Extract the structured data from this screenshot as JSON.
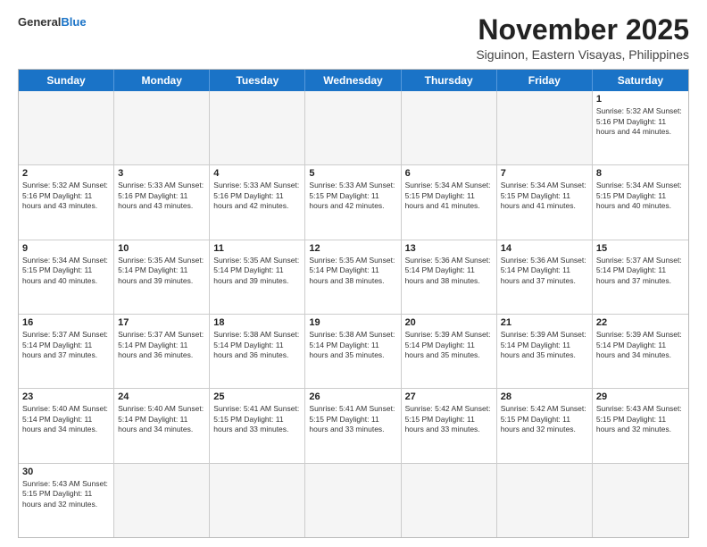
{
  "header": {
    "logo_line1": "General",
    "logo_line2": "Blue",
    "title": "November 2025",
    "subtitle": "Siguinon, Eastern Visayas, Philippines"
  },
  "weekdays": [
    "Sunday",
    "Monday",
    "Tuesday",
    "Wednesday",
    "Thursday",
    "Friday",
    "Saturday"
  ],
  "rows": [
    [
      {
        "day": "",
        "info": ""
      },
      {
        "day": "",
        "info": ""
      },
      {
        "day": "",
        "info": ""
      },
      {
        "day": "",
        "info": ""
      },
      {
        "day": "",
        "info": ""
      },
      {
        "day": "",
        "info": ""
      },
      {
        "day": "1",
        "info": "Sunrise: 5:32 AM\nSunset: 5:16 PM\nDaylight: 11 hours and 44 minutes."
      }
    ],
    [
      {
        "day": "2",
        "info": "Sunrise: 5:32 AM\nSunset: 5:16 PM\nDaylight: 11 hours and 43 minutes."
      },
      {
        "day": "3",
        "info": "Sunrise: 5:33 AM\nSunset: 5:16 PM\nDaylight: 11 hours and 43 minutes."
      },
      {
        "day": "4",
        "info": "Sunrise: 5:33 AM\nSunset: 5:16 PM\nDaylight: 11 hours and 42 minutes."
      },
      {
        "day": "5",
        "info": "Sunrise: 5:33 AM\nSunset: 5:15 PM\nDaylight: 11 hours and 42 minutes."
      },
      {
        "day": "6",
        "info": "Sunrise: 5:34 AM\nSunset: 5:15 PM\nDaylight: 11 hours and 41 minutes."
      },
      {
        "day": "7",
        "info": "Sunrise: 5:34 AM\nSunset: 5:15 PM\nDaylight: 11 hours and 41 minutes."
      },
      {
        "day": "8",
        "info": "Sunrise: 5:34 AM\nSunset: 5:15 PM\nDaylight: 11 hours and 40 minutes."
      }
    ],
    [
      {
        "day": "9",
        "info": "Sunrise: 5:34 AM\nSunset: 5:15 PM\nDaylight: 11 hours and 40 minutes."
      },
      {
        "day": "10",
        "info": "Sunrise: 5:35 AM\nSunset: 5:14 PM\nDaylight: 11 hours and 39 minutes."
      },
      {
        "day": "11",
        "info": "Sunrise: 5:35 AM\nSunset: 5:14 PM\nDaylight: 11 hours and 39 minutes."
      },
      {
        "day": "12",
        "info": "Sunrise: 5:35 AM\nSunset: 5:14 PM\nDaylight: 11 hours and 38 minutes."
      },
      {
        "day": "13",
        "info": "Sunrise: 5:36 AM\nSunset: 5:14 PM\nDaylight: 11 hours and 38 minutes."
      },
      {
        "day": "14",
        "info": "Sunrise: 5:36 AM\nSunset: 5:14 PM\nDaylight: 11 hours and 37 minutes."
      },
      {
        "day": "15",
        "info": "Sunrise: 5:37 AM\nSunset: 5:14 PM\nDaylight: 11 hours and 37 minutes."
      }
    ],
    [
      {
        "day": "16",
        "info": "Sunrise: 5:37 AM\nSunset: 5:14 PM\nDaylight: 11 hours and 37 minutes."
      },
      {
        "day": "17",
        "info": "Sunrise: 5:37 AM\nSunset: 5:14 PM\nDaylight: 11 hours and 36 minutes."
      },
      {
        "day": "18",
        "info": "Sunrise: 5:38 AM\nSunset: 5:14 PM\nDaylight: 11 hours and 36 minutes."
      },
      {
        "day": "19",
        "info": "Sunrise: 5:38 AM\nSunset: 5:14 PM\nDaylight: 11 hours and 35 minutes."
      },
      {
        "day": "20",
        "info": "Sunrise: 5:39 AM\nSunset: 5:14 PM\nDaylight: 11 hours and 35 minutes."
      },
      {
        "day": "21",
        "info": "Sunrise: 5:39 AM\nSunset: 5:14 PM\nDaylight: 11 hours and 35 minutes."
      },
      {
        "day": "22",
        "info": "Sunrise: 5:39 AM\nSunset: 5:14 PM\nDaylight: 11 hours and 34 minutes."
      }
    ],
    [
      {
        "day": "23",
        "info": "Sunrise: 5:40 AM\nSunset: 5:14 PM\nDaylight: 11 hours and 34 minutes."
      },
      {
        "day": "24",
        "info": "Sunrise: 5:40 AM\nSunset: 5:14 PM\nDaylight: 11 hours and 34 minutes."
      },
      {
        "day": "25",
        "info": "Sunrise: 5:41 AM\nSunset: 5:15 PM\nDaylight: 11 hours and 33 minutes."
      },
      {
        "day": "26",
        "info": "Sunrise: 5:41 AM\nSunset: 5:15 PM\nDaylight: 11 hours and 33 minutes."
      },
      {
        "day": "27",
        "info": "Sunrise: 5:42 AM\nSunset: 5:15 PM\nDaylight: 11 hours and 33 minutes."
      },
      {
        "day": "28",
        "info": "Sunrise: 5:42 AM\nSunset: 5:15 PM\nDaylight: 11 hours and 32 minutes."
      },
      {
        "day": "29",
        "info": "Sunrise: 5:43 AM\nSunset: 5:15 PM\nDaylight: 11 hours and 32 minutes."
      }
    ],
    [
      {
        "day": "30",
        "info": "Sunrise: 5:43 AM\nSunset: 5:15 PM\nDaylight: 11 hours and 32 minutes."
      },
      {
        "day": "",
        "info": ""
      },
      {
        "day": "",
        "info": ""
      },
      {
        "day": "",
        "info": ""
      },
      {
        "day": "",
        "info": ""
      },
      {
        "day": "",
        "info": ""
      },
      {
        "day": "",
        "info": ""
      }
    ]
  ]
}
